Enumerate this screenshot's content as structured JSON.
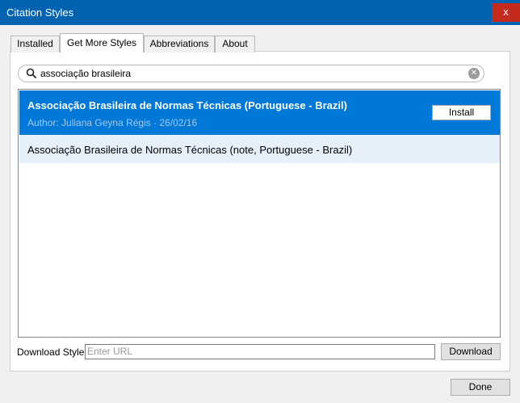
{
  "window": {
    "title": "Citation Styles",
    "close_label": "x"
  },
  "tabs": [
    {
      "label": "Installed"
    },
    {
      "label": "Get More Styles",
      "active": true
    },
    {
      "label": "Abbreviations"
    },
    {
      "label": "About"
    }
  ],
  "search": {
    "value": "associação brasileira"
  },
  "results": [
    {
      "name": "Associação Brasileira de Normas Técnicas (Portuguese - Brazil)",
      "author": "Author: Juliana Geyna Régis · 26/02/16",
      "action_label": "Install",
      "selected": true
    },
    {
      "name": "Associação Brasileira de Normas Técnicas (note, Portuguese - Brazil)"
    }
  ],
  "download": {
    "label": "Download Style:",
    "placeholder": "Enter URL",
    "button_label": "Download"
  },
  "footer": {
    "done_label": "Done"
  },
  "colors": {
    "titlebar": "#0063b1",
    "close": "#c42b1c",
    "selection": "#0078d7",
    "hover_row": "#e6f0fb"
  }
}
